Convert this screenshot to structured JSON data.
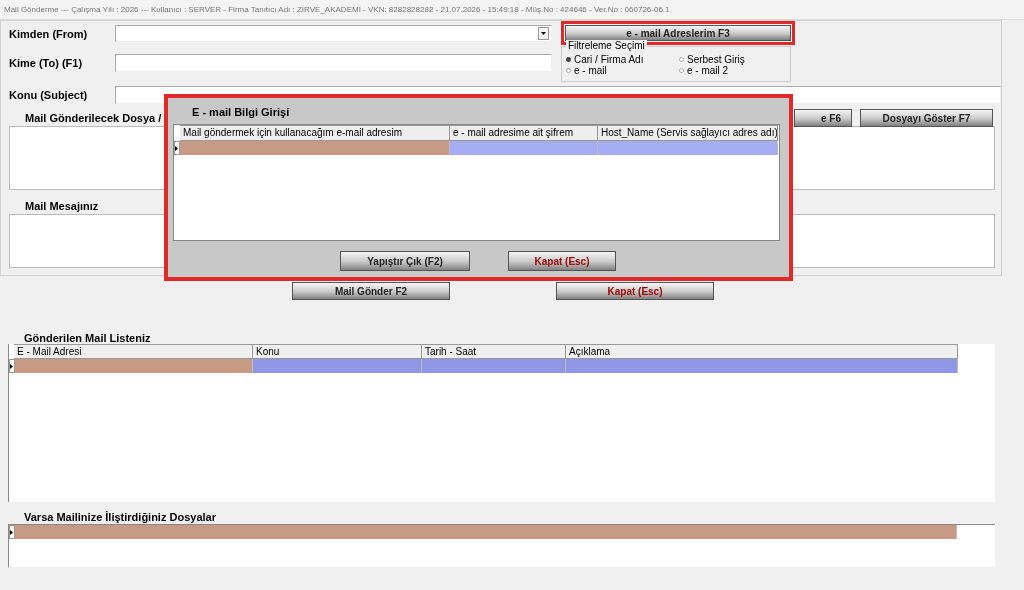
{
  "window": {
    "title": "Mail Gönderme  ---  Çalışma Yılı : 2026  ---  Kullanıcı : SERVER - Firma Tanıtıcı Adı : ZİRVE_AKADEMİ - VKN: 8282828282 - 21.07.2026 - 15:49:18 - Müş.No : 424646 - Ver.No : 060726-06.1"
  },
  "form": {
    "from_label": "Kimden (From)",
    "to_label": "Kime (To) (F1)",
    "subject_label": "Konu (Subject)",
    "addresses_button": {
      "label": "e - mail Adreslerim F3",
      "highlighted": true
    },
    "filter": {
      "title": "Filtreleme Seçimi",
      "options": [
        {
          "label": "Cari / Firma Adı",
          "selected": true
        },
        {
          "label": "Serbest Giriş",
          "selected": false
        },
        {
          "label": "e - mail",
          "selected": false
        },
        {
          "label": "e - mail 2",
          "selected": false
        }
      ]
    },
    "attachments_label": "Mail Gönderilecek Dosya /",
    "file_buttons": [
      {
        "label": "e F6"
      },
      {
        "label": "Dosyayı Göster F7"
      }
    ],
    "message_label": "Mail Mesajınız"
  },
  "actions": [
    {
      "label": "Mail Gönder F2",
      "kind": "normal"
    },
    {
      "label": "Kapat (Esc)",
      "kind": "close"
    }
  ],
  "sent_list": {
    "title": "Gönderilen Mail Listeniz",
    "columns": [
      {
        "label": "E - Mail Adresi",
        "color": "#c89a85"
      },
      {
        "label": "Konu",
        "color": "#9097e4"
      },
      {
        "label": "Tarih - Saat",
        "color": "#9097e4"
      },
      {
        "label": "Açıklama",
        "color": "#9097e4"
      }
    ]
  },
  "attached_files": {
    "title": "Varsa Mailinize İliştirdiğiniz Dosyalar",
    "row": {
      "color": "#c89a85"
    }
  },
  "dialog": {
    "title": "E - mail Bilgi Girişi",
    "highlighted": true,
    "columns": [
      {
        "label": "Mail göndermek için kullanacağım e-mail adresim",
        "color": "#c89a85"
      },
      {
        "label": "e - mail adresime ait şifrem",
        "color": "#a6acf6"
      },
      {
        "label": "Host_Name (Servis sağlayıcı adres adı)",
        "color": "#a6acf6"
      }
    ],
    "buttons": [
      {
        "label": "Yapıştır Çık (F2)",
        "kind": "normal"
      },
      {
        "label": "Kapat (Esc)",
        "kind": "close"
      }
    ]
  }
}
